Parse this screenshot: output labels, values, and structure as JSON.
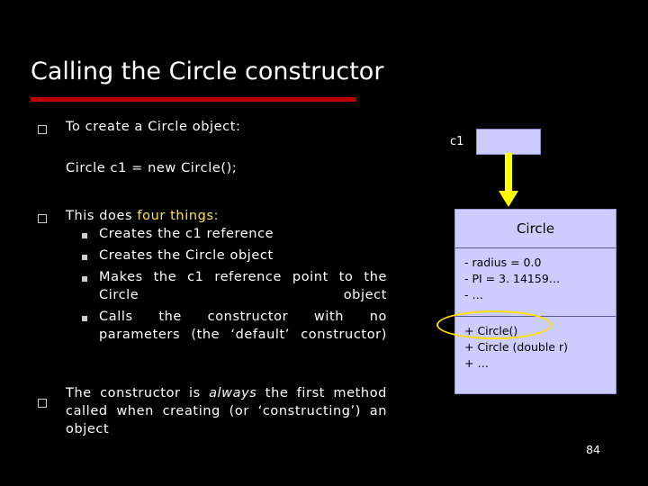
{
  "slide": {
    "title": "Calling the Circle constructor",
    "page_number": "84",
    "bullets": [
      {
        "marker": "square-outline",
        "lines": [
          "To create a Circle object:"
        ]
      },
      {
        "marker": "none",
        "lines": [
          "Circle c1 = new Circle();"
        ]
      },
      {
        "marker": "square-outline",
        "lead": "This does ",
        "lead_highlight": "four things:",
        "sub_items": [
          "Creates the c1 reference",
          "Creates the Circle object",
          "Makes  the  c1  reference  point to the Circle object",
          "Calls  the  constructor  with  no parameters    (the    ‘default’ constructor)"
        ]
      },
      {
        "marker": "square-outline",
        "lines_rich": {
          "pre": "The  constructor  is  ",
          "emphasis": "always",
          "post": "  the  first method  called  when  creating  (or ‘constructing’) an object"
        }
      }
    ]
  },
  "diagram": {
    "reference_label": "c1",
    "reference_box_fill": "#ccccfd",
    "arrow_color": "#ffff00",
    "class_box": {
      "name": "Circle",
      "attributes": [
        "- radius = 0.0",
        "- PI = 3. 14159…",
        "- …"
      ],
      "operations": [
        "+ Circle()",
        "+ Circle (double r)",
        "+ …"
      ],
      "fill": "#ccccfd",
      "highlight_color": "#ffe000",
      "highlighted_operation": "+ Circle()"
    }
  },
  "colors": {
    "background": "#000000",
    "title_rule": "#bb0000",
    "highlight_text": "#ffe44d",
    "body_text": "#ffffff"
  }
}
